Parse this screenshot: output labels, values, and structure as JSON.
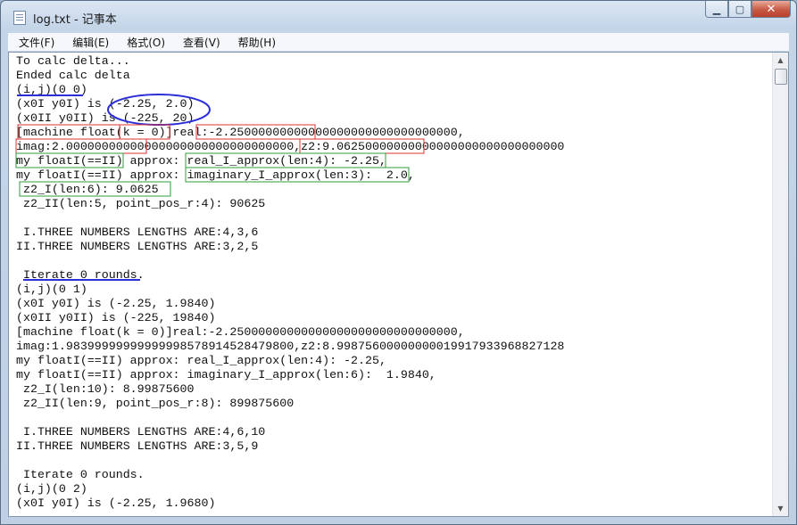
{
  "window": {
    "title": "log.txt - 记事本",
    "min_label": "▁",
    "max_label": "▢",
    "close_label": "✕"
  },
  "menu": [
    "文件(F)",
    "编辑(E)",
    "格式(O)",
    "查看(V)",
    "帮助(H)"
  ],
  "lines": [
    "To calc delta...",
    "Ended calc delta",
    "(i,j)(0 0)",
    "(x0I y0I) is (-2.25, 2.0)",
    "(x0II y0II) is (-225, 20)",
    "[machine float(k = 0)]real:-2.25000000000000000000000000000000,",
    "imag:2.00000000000000000000000000000000,z2:9.06250000000000000000000000000000",
    "my floatI(==II) approx: real_I_approx(len:4): -2.25,",
    "my floatI(==II) approx: imaginary_I_approx(len:3):  2.0,",
    " z2_I(len:6): 9.0625",
    " z2_II(len:5, point_pos_r:4): 90625",
    "",
    " I.THREE NUMBERS LENGTHS ARE:4,3,6",
    "II.THREE NUMBERS LENGTHS ARE:3,2,5",
    "",
    " Iterate 0 rounds.",
    "(i,j)(0 1)",
    "(x0I y0I) is (-2.25, 1.9840)",
    "(x0II y0II) is (-225, 19840)",
    "[machine float(k = 0)]real:-2.25000000000000000000000000000000,",
    "imag:1.98399999999999998578914528479800,z2:8.99875600000000019917933968827128",
    "my floatI(==II) approx: real_I_approx(len:4): -2.25,",
    "my floatI(==II) approx: imaginary_I_approx(len:6):  1.9840,",
    " z2_I(len:10): 8.99875600",
    " z2_II(len:9, point_pos_r:8): 899875600",
    "",
    " I.THREE NUMBERS LENGTHS ARE:4,6,10",
    "II.THREE NUMBERS LENGTHS ARE:3,5,9",
    "",
    " Iterate 0 rounds.",
    "(i,j)(0 2)",
    "(x0I y0I) is (-2.25, 1.9680)"
  ],
  "annotation_colors": {
    "blue": "#2a2fd8",
    "red": "#e03030",
    "green": "#2f9e3c"
  }
}
